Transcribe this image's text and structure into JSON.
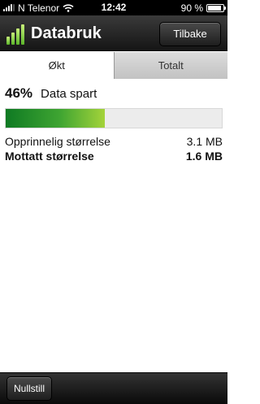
{
  "status_bar": {
    "carrier": "N Telenor",
    "time": "12:42",
    "battery_text": "90 %",
    "battery_level": 0.9,
    "signal_bars": 4
  },
  "nav": {
    "title": "Databruk",
    "back_label": "Tilbake",
    "logo_icon": "bar-chart-icon"
  },
  "tabs": [
    {
      "label": "Økt",
      "active": true
    },
    {
      "label": "Totalt",
      "active": false
    }
  ],
  "summary": {
    "saved_percent_text": "46%",
    "saved_label": "Data spart",
    "saved_fraction": 0.46
  },
  "sizes": {
    "original_label": "Opprinnelig størrelse",
    "original_value": "3.1 MB",
    "received_label": "Mottatt størrelse",
    "received_value": "1.6 MB"
  },
  "toolbar": {
    "reset_label": "Nullstill"
  },
  "colors": {
    "progress_start": "#0f7a23",
    "progress_end": "#a4d33a",
    "bar_background": "#151515"
  }
}
